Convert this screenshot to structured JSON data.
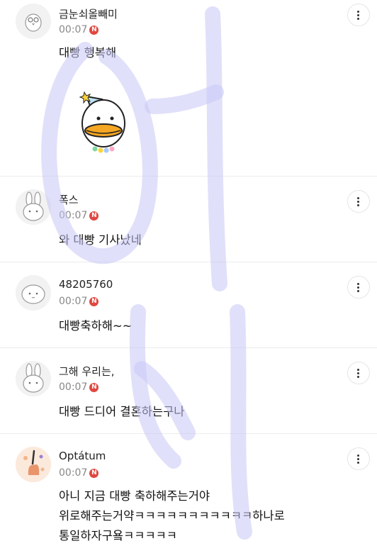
{
  "comments": [
    {
      "author": "금눈쇠올빼미",
      "time": "00:07",
      "badge": "N",
      "text": "대빵 행복해",
      "avatar_icon": "owl-icon",
      "sticker": "party-duck-sticker"
    },
    {
      "author": "폭스",
      "time": "00:07",
      "badge": "N",
      "text": "와 대빵 기사났네",
      "avatar_icon": "rabbit-icon"
    },
    {
      "author": "48205760",
      "time": "00:07",
      "badge": "N",
      "text": "대빵축하해~~",
      "avatar_icon": "blob-face-icon"
    },
    {
      "author": "그해 우리는,",
      "time": "00:07",
      "badge": "N",
      "text": "대빵 드디어 결혼하는구나",
      "avatar_icon": "rabbit-icon"
    },
    {
      "author": "Optátum",
      "time": "00:07",
      "badge": "N",
      "text_lines": [
        "아니 지금 대빵 축하해주는거야",
        "위로해주는거약ㅋㅋㅋㅋㅋㅋㅋㅋㅋㅋㅋ하나로",
        "통일하자구욬ㅋㅋㅋㅋㅋ"
      ],
      "avatar_icon": "painted-hand-icon"
    }
  ],
  "colors": {
    "badge": "#e0473f",
    "watermark": "#c9c6f5"
  }
}
